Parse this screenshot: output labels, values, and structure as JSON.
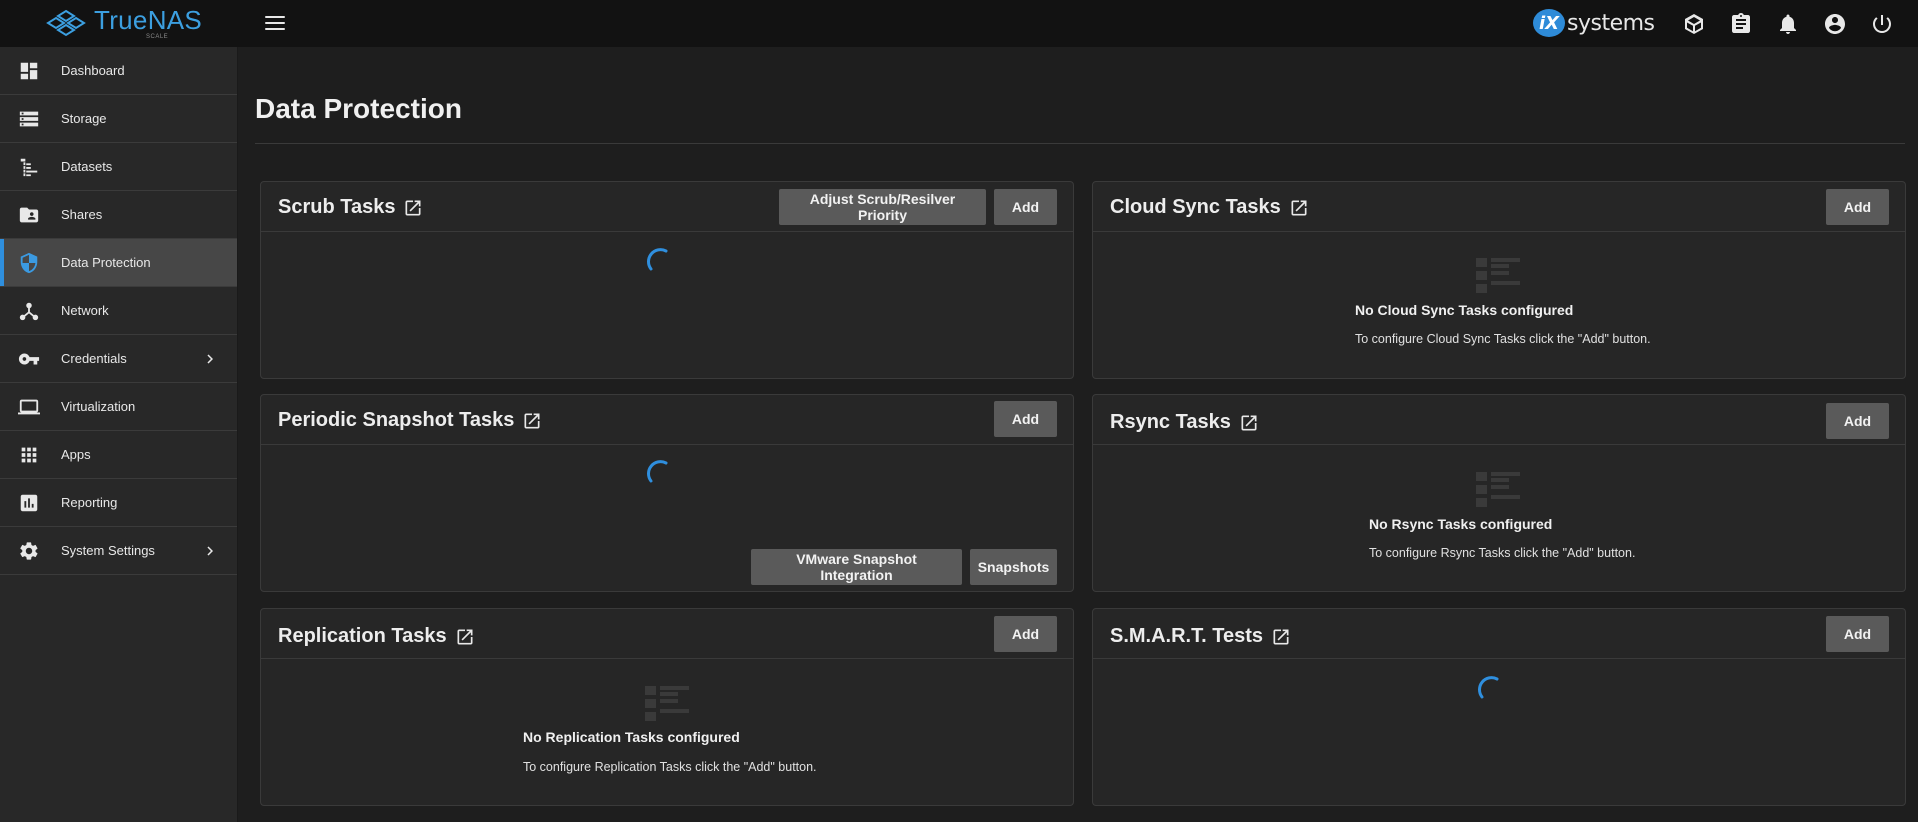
{
  "app": {
    "brand": "TrueNAS",
    "edition": "SCALE",
    "vendor_logo": "iXsystems",
    "vendor_ix": "iX",
    "vendor_text": "systems",
    "accent": "#2f8fde"
  },
  "topbar": {
    "icons": [
      "truecommand-icon",
      "clipboard-icon",
      "bell-icon",
      "account-icon",
      "power-icon"
    ]
  },
  "sidebar": {
    "items": [
      {
        "label": "Dashboard",
        "icon": "dashboard-icon"
      },
      {
        "label": "Storage",
        "icon": "storage-icon"
      },
      {
        "label": "Datasets",
        "icon": "datasets-icon"
      },
      {
        "label": "Shares",
        "icon": "shares-icon"
      },
      {
        "label": "Data Protection",
        "icon": "shield-icon",
        "active": true
      },
      {
        "label": "Network",
        "icon": "network-icon"
      },
      {
        "label": "Credentials",
        "icon": "key-icon",
        "has_children": true
      },
      {
        "label": "Virtualization",
        "icon": "laptop-icon"
      },
      {
        "label": "Apps",
        "icon": "apps-grid-icon"
      },
      {
        "label": "Reporting",
        "icon": "chart-icon"
      },
      {
        "label": "System Settings",
        "icon": "gear-icon",
        "has_children": true
      }
    ]
  },
  "main": {
    "title": "Data Protection",
    "cards": {
      "scrub": {
        "title": "Scrub Tasks",
        "priority_button": "Adjust Scrub/Resilver Priority",
        "add_button": "Add",
        "state": "loading"
      },
      "cloud_sync": {
        "title": "Cloud Sync Tasks",
        "add_button": "Add",
        "empty_title": "No Cloud Sync Tasks configured",
        "empty_desc": "To configure Cloud Sync Tasks click the \"Add\" button."
      },
      "snapshot": {
        "title": "Periodic Snapshot Tasks",
        "add_button": "Add",
        "vmware_button": "VMware Snapshot Integration",
        "snapshots_button": "Snapshots",
        "state": "loading"
      },
      "rsync": {
        "title": "Rsync Tasks",
        "add_button": "Add",
        "empty_title": "No Rsync Tasks configured",
        "empty_desc": "To configure Rsync Tasks click the \"Add\" button."
      },
      "replication": {
        "title": "Replication Tasks",
        "add_button": "Add",
        "empty_title": "No Replication Tasks configured",
        "empty_desc": "To configure Replication Tasks click the \"Add\" button."
      },
      "smart": {
        "title": "S.M.A.R.T. Tests",
        "add_button": "Add",
        "state": "loading"
      }
    }
  }
}
